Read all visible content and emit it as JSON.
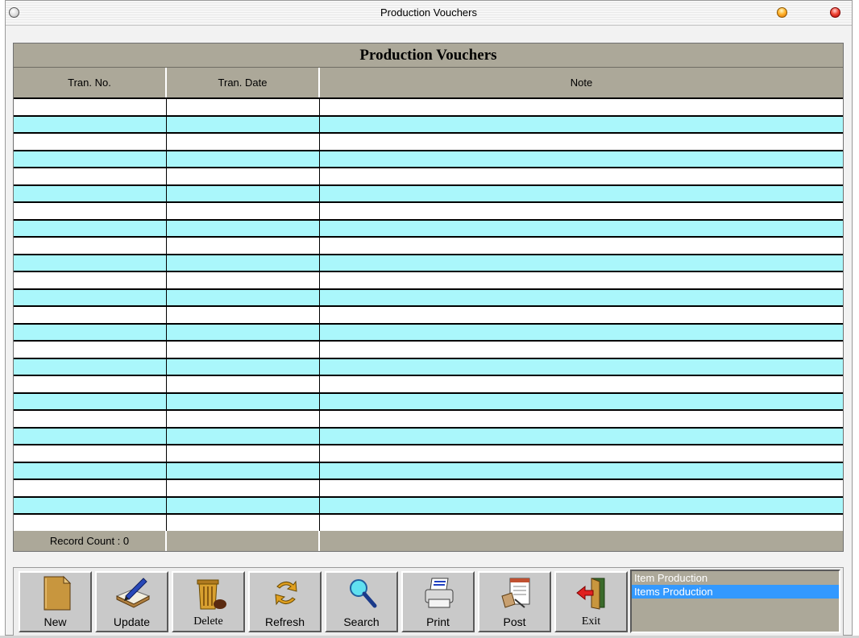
{
  "window": {
    "title": "Production Vouchers"
  },
  "grid": {
    "title": "Production Vouchers",
    "columns": [
      "Tran. No.",
      "Tran. Date",
      "Note"
    ],
    "rows": [],
    "footer": {
      "record_count": "Record Count : 0"
    }
  },
  "toolbar": {
    "buttons": [
      {
        "label": "New",
        "icon": "new-document-icon"
      },
      {
        "label": "Update",
        "icon": "pen-book-icon"
      },
      {
        "label": "Delete",
        "icon": "trash-can-icon"
      },
      {
        "label": "Refresh",
        "icon": "refresh-arrows-icon"
      },
      {
        "label": "Search",
        "icon": "magnifier-icon"
      },
      {
        "label": "Print",
        "icon": "printer-icon"
      },
      {
        "label": "Post",
        "icon": "stamp-post-icon"
      },
      {
        "label": "Exit",
        "icon": "exit-door-icon"
      }
    ]
  },
  "list": {
    "items": [
      "Item Production",
      "Items Production"
    ],
    "selected": "Items Production"
  },
  "colors": {
    "header_bg": "#aca899",
    "row_even": "#aaf7fb",
    "row_odd": "#ffffff",
    "selection": "#3399ff"
  }
}
